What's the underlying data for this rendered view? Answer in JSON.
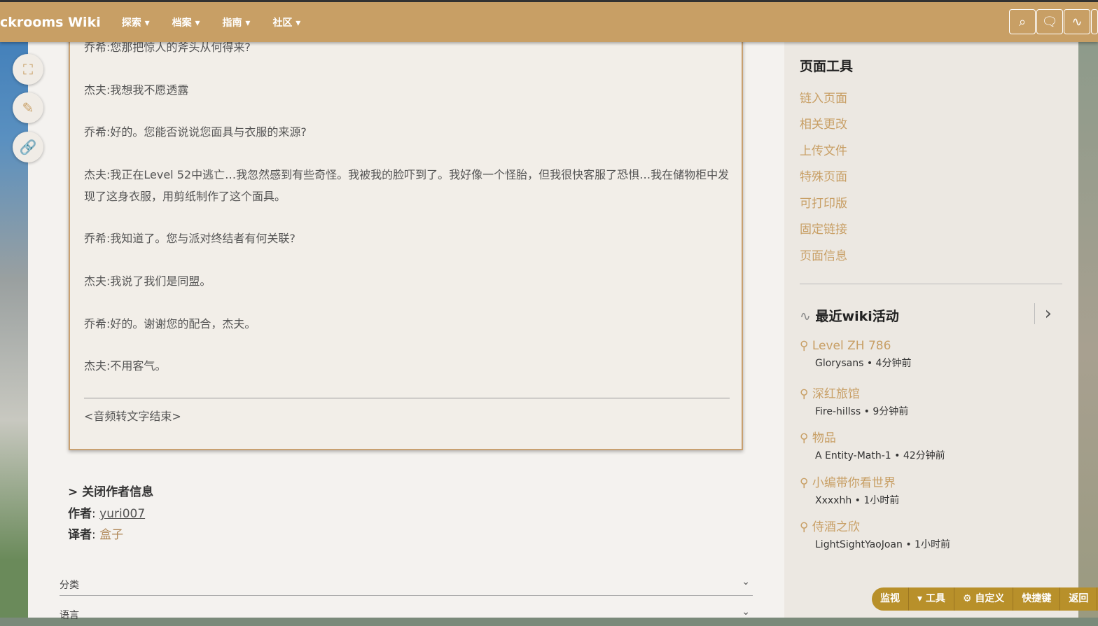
{
  "header": {
    "logo": "ckrooms Wiki",
    "nav": [
      "探索 ▾",
      "档案 ▾",
      "指南 ▾",
      "社区 ▾"
    ]
  },
  "dialogue": [
    "乔希:您那把惊人的斧头从何得来?",
    "杰夫:我想我不愿透露",
    "乔希:好的。您能否说说您面具与衣服的来源?",
    "杰夫:我正在Level 52中逃亡…我忽然感到有些奇怪。我被我的脸吓到了。我好像一个怪胎，但我很快客服了恐惧…我在储物柜中发现了这身衣服，用剪纸制作了这个面具。",
    "乔希:我知道了。您与派对终结者有何关联?",
    "杰夫:我说了我们是同盟。",
    "乔希:好的。谢谢您的配合，杰夫。",
    "杰夫:不用客气。"
  ],
  "end_note": "<音频转文字结束>",
  "author_info": {
    "toggle": "> 关闭作者信息",
    "author_label": "作者",
    "author": "yuri007",
    "translator_label": "译者",
    "translator": "盒子"
  },
  "folds": [
    "分类",
    "语言"
  ],
  "page_tools": {
    "title": "页面工具",
    "links": [
      "链入页面",
      "相关更改",
      "上传文件",
      "特殊页面",
      "可打印版",
      "固定链接",
      "页面信息"
    ]
  },
  "recent": {
    "title": "最近wiki活动",
    "items": [
      {
        "title": "Level ZH 786",
        "meta": "Glorysans • 4分钟前"
      },
      {
        "title": "深红旅馆",
        "meta": "Fire-hillss • 9分钟前"
      },
      {
        "title": "物品",
        "meta": "A Entity-Math-1 • 42分钟前"
      },
      {
        "title": "小编带你看世界",
        "meta": "Xxxxhh • 1小时前"
      },
      {
        "title": "侍酒之欣",
        "meta": "LightSightYaoJoan • 1小时前"
      }
    ]
  },
  "bottom_bar": [
    "监视",
    "▾ 工具",
    "⚙ 自定义",
    "快捷键",
    "返回"
  ]
}
